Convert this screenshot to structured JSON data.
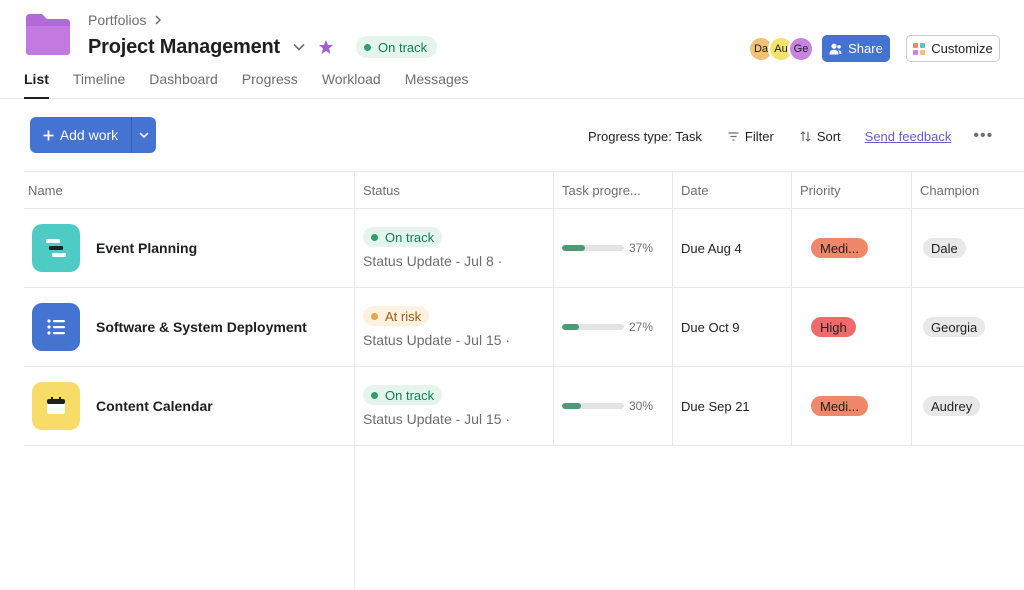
{
  "header": {
    "breadcrumb": "Portfolios",
    "title": "Project Management",
    "status": "On track",
    "colors": {
      "folder": "#b469d9",
      "star": "#a35ed0",
      "on_track_bg": "#e6f5ec",
      "on_track_text": "#0d7f56"
    }
  },
  "avatars": [
    {
      "initials": "Da",
      "color": "#f3c07a"
    },
    {
      "initials": "Au",
      "color": "#f4e26c"
    },
    {
      "initials": "Ge",
      "color": "#c983e0"
    }
  ],
  "actions": {
    "share": "Share",
    "customize": "Customize",
    "share_color": "#4573d2"
  },
  "tabs": [
    {
      "label": "List",
      "active": true
    },
    {
      "label": "Timeline"
    },
    {
      "label": "Dashboard"
    },
    {
      "label": "Progress"
    },
    {
      "label": "Workload"
    },
    {
      "label": "Messages"
    }
  ],
  "toolbar": {
    "add_work": "Add work",
    "progress_type": "Progress type: Task",
    "filter": "Filter",
    "sort": "Sort",
    "send_feedback": "Send feedback"
  },
  "table": {
    "columns": [
      "Name",
      "Status",
      "Task progre...",
      "Date",
      "Priority",
      "Champion"
    ],
    "rows": [
      {
        "name": "Event Planning",
        "icon": "timeline-icon",
        "icon_color": "#4ecbc4",
        "status": "On track",
        "status_color": "#2e9e6c",
        "status_bg": "#e6f5ec",
        "status_text_color": "#0d7f56",
        "status_update": "Status Update - Jul 8 ·",
        "progress": 0.37,
        "progress_label": "37%",
        "date": "Due Aug 4",
        "priority": "Medi...",
        "priority_color": "#f0876a",
        "champion": "Dale"
      },
      {
        "name": "Software & System Deployment",
        "icon": "list-icon",
        "icon_color": "#4573d2",
        "status": "At risk",
        "status_color": "#e8a54a",
        "status_bg": "#fdf1e0",
        "status_text_color": "#a05c0b",
        "status_update": "Status Update - Jul 15 ·",
        "progress": 0.27,
        "progress_label": "27%",
        "date": "Due Oct 9",
        "priority": "High",
        "priority_color": "#ef6b6b",
        "champion": "Georgia"
      },
      {
        "name": "Content Calendar",
        "icon": "calendar-icon",
        "icon_color": "#f8dc6a",
        "status": "On track",
        "status_color": "#2e9e6c",
        "status_bg": "#e6f5ec",
        "status_text_color": "#0d7f56",
        "status_update": "Status Update - Jul 15 ·",
        "progress": 0.3,
        "progress_label": "30%",
        "date": "Due Sep 21",
        "priority": "Medi...",
        "priority_color": "#f0876a",
        "champion": "Audrey"
      }
    ]
  }
}
